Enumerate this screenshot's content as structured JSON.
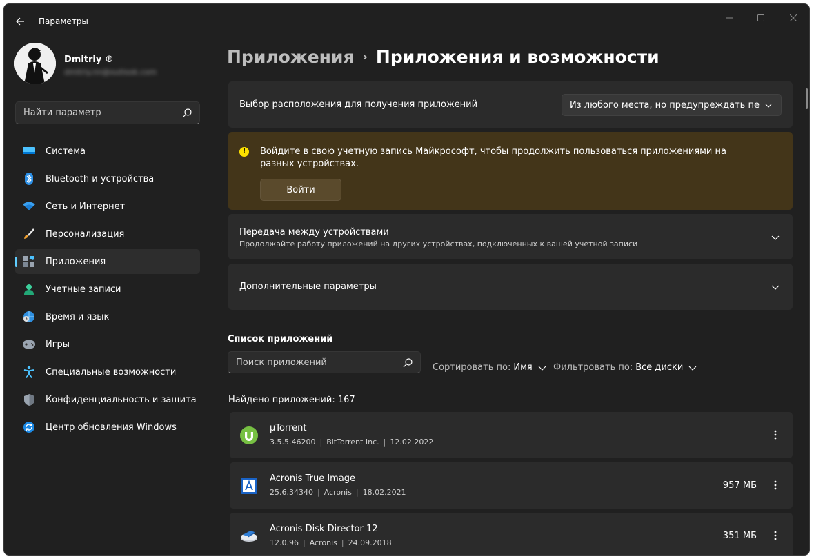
{
  "window": {
    "title": "Параметры"
  },
  "profile": {
    "name": "Dmitriy ®",
    "email": "dmitriy.nn@outlook.com"
  },
  "search": {
    "placeholder": "Найти параметр"
  },
  "sidebar": {
    "items": [
      {
        "label": "Система",
        "icon": "monitor-icon"
      },
      {
        "label": "Bluetooth и устройства",
        "icon": "bluetooth-icon"
      },
      {
        "label": "Сеть и Интернет",
        "icon": "wifi-icon"
      },
      {
        "label": "Персонализация",
        "icon": "brush-icon"
      },
      {
        "label": "Приложения",
        "icon": "apps-icon",
        "active": true
      },
      {
        "label": "Учетные записи",
        "icon": "person-icon"
      },
      {
        "label": "Время и язык",
        "icon": "globe-clock-icon"
      },
      {
        "label": "Игры",
        "icon": "gamepad-icon"
      },
      {
        "label": "Специальные возможности",
        "icon": "accessibility-icon"
      },
      {
        "label": "Конфиденциальность и защита",
        "icon": "shield-icon"
      },
      {
        "label": "Центр обновления Windows",
        "icon": "update-icon"
      }
    ]
  },
  "breadcrumb": {
    "parent": "Приложения",
    "separator": "›",
    "current": "Приложения и возможности"
  },
  "install_source": {
    "label": "Выбор расположения для получения приложений",
    "value": "Из любого места, но предупреждать пере"
  },
  "signin_banner": {
    "text": "Войдите в свою учетную запись Майкрософт, чтобы продолжить пользоваться приложениями на разных устройствах.",
    "button": "Войти"
  },
  "share_across": {
    "title": "Передача между устройствами",
    "subtitle": "Продолжайте работу приложений на других устройствах, подключенных к вашей учетной записи"
  },
  "advanced": {
    "title": "Дополнительные параметры"
  },
  "app_list": {
    "heading": "Список приложений",
    "search_placeholder": "Поиск приложений",
    "sort_label": "Сортировать по:",
    "sort_value": "Имя",
    "filter_label": "Фильтровать по:",
    "filter_value": "Все диски",
    "found": "Найдено приложений: 167",
    "apps": [
      {
        "name": "µTorrent",
        "version": "3.5.5.46200",
        "publisher": "BitTorrent Inc.",
        "date": "12.02.2022",
        "size": "",
        "icon": "utorrent-icon"
      },
      {
        "name": "Acronis True Image",
        "version": "25.6.34340",
        "publisher": "Acronis",
        "date": "18.02.2021",
        "size": "957 МБ",
        "icon": "acronis-true-image-icon"
      },
      {
        "name": "Acronis Disk Director 12",
        "version": "12.0.96",
        "publisher": "Acronis",
        "date": "24.09.2018",
        "size": "351 МБ",
        "icon": "acronis-disk-director-icon"
      }
    ]
  },
  "colors": {
    "accent": "#60cdff",
    "background": "#202020",
    "card": "#2b2b2b",
    "warning_bg": "#433519",
    "warning_icon": "#fce100"
  }
}
